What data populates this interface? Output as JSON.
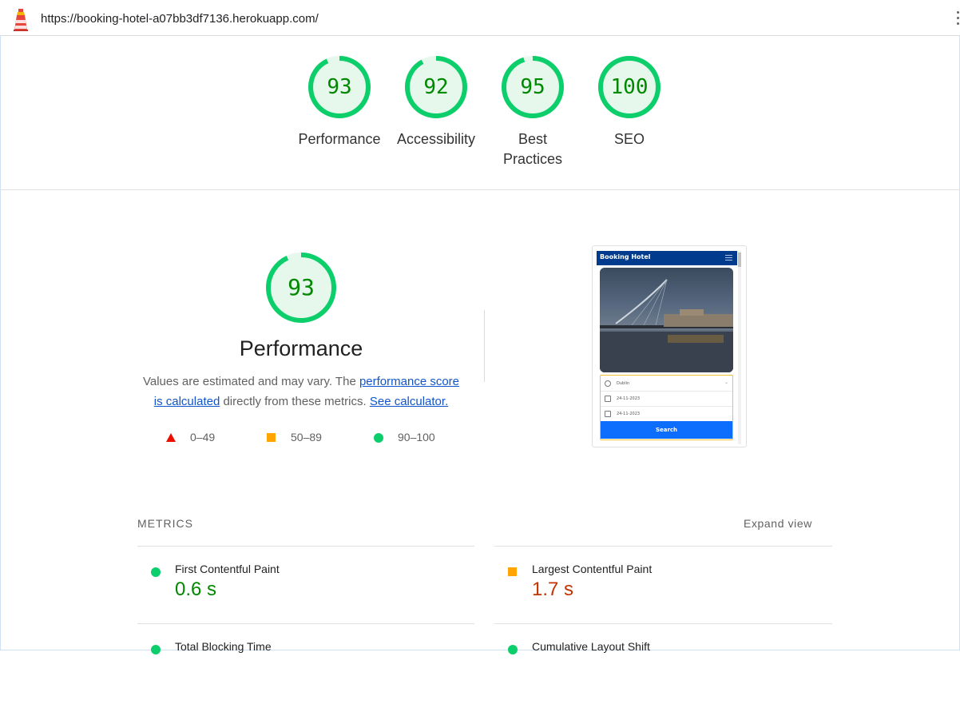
{
  "browser": {
    "url": "https://booking-hotel-a07bb3df7136.herokuapp.com/"
  },
  "category_scores": [
    {
      "score": "93",
      "label": "Performance"
    },
    {
      "score": "92",
      "label": "Accessibility"
    },
    {
      "score": "95",
      "label": "Best Practices"
    },
    {
      "score": "100",
      "label": "SEO"
    }
  ],
  "performance": {
    "score": "93",
    "title": "Performance",
    "desc_before": "Values are estimated and may vary. The ",
    "link_score": "performance score is calculated",
    "desc_middle": " directly from these metrics. ",
    "link_calculator": "See calculator.",
    "legend": [
      {
        "range": "0–49",
        "shape": "triangle",
        "color": "#eb0f00"
      },
      {
        "range": "50–89",
        "shape": "square",
        "color": "#ffa400"
      },
      {
        "range": "90–100",
        "shape": "circle",
        "color": "#0cce6b"
      }
    ],
    "score_color": "#0cce6b"
  },
  "screenshot": {
    "brand": "Booking Hotel",
    "location": "Dublin",
    "checkin": "24-11-2023",
    "checkout": "24-11-2023",
    "search_label": "Search"
  },
  "metrics": {
    "heading": "METRICS",
    "expand_label": "Expand view",
    "items": [
      {
        "name": "First Contentful Paint",
        "value": "0.6 s",
        "rating": "pass",
        "color": "#008800"
      },
      {
        "name": "Largest Contentful Paint",
        "value": "1.7 s",
        "rating": "average",
        "color": "#c33300"
      },
      {
        "name": "Total Blocking Time",
        "value": "",
        "rating": "pass"
      },
      {
        "name": "Cumulative Layout Shift",
        "value": "",
        "rating": "pass"
      }
    ]
  }
}
